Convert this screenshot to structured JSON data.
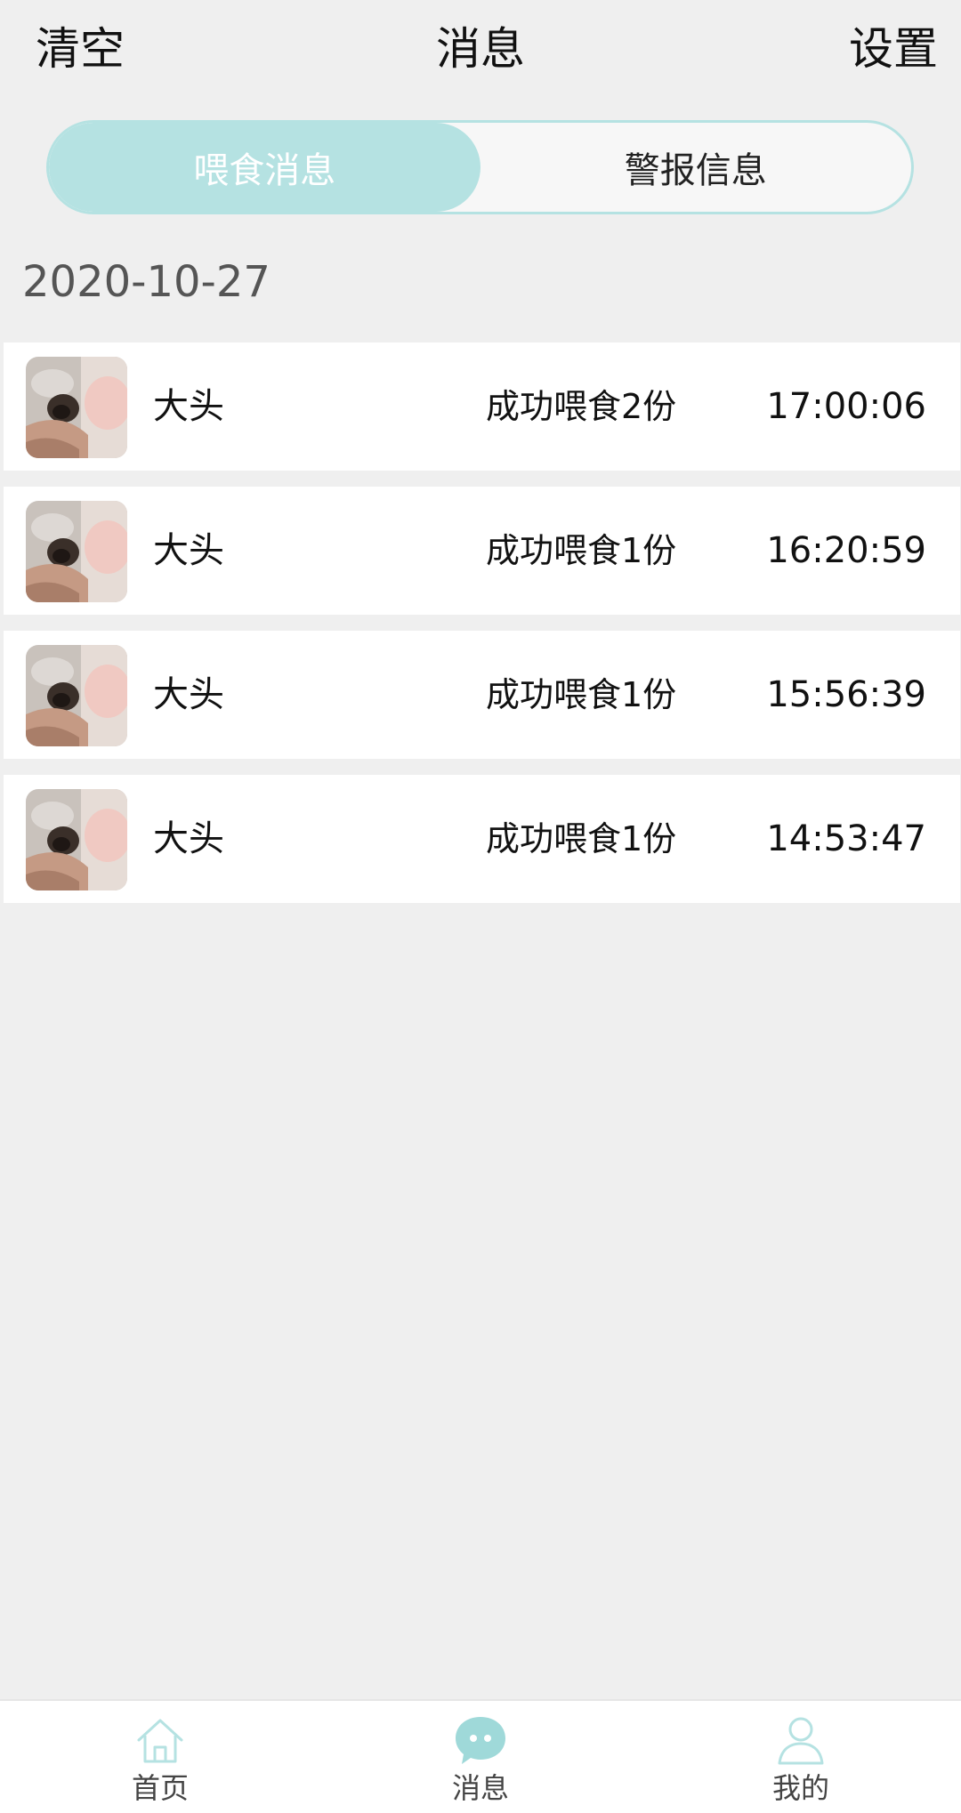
{
  "header": {
    "clear_label": "清空",
    "title": "消息",
    "settings_label": "设置"
  },
  "segmented": {
    "tabs": [
      {
        "label": "喂食消息",
        "active": true
      },
      {
        "label": "警报信息",
        "active": false
      }
    ]
  },
  "date_header": "2020-10-27",
  "messages": [
    {
      "name": "大头",
      "message": "成功喂食2份",
      "time": "17:00:06"
    },
    {
      "name": "大头",
      "message": "成功喂食1份",
      "time": "16:20:59"
    },
    {
      "name": "大头",
      "message": "成功喂食1份",
      "time": "15:56:39"
    },
    {
      "name": "大头",
      "message": "成功喂食1份",
      "time": "14:53:47"
    }
  ],
  "tabbar": {
    "items": [
      {
        "label": "首页",
        "icon": "home-icon",
        "active": false
      },
      {
        "label": "消息",
        "icon": "chat-bubble-icon",
        "active": true
      },
      {
        "label": "我的",
        "icon": "user-icon",
        "active": false
      }
    ]
  },
  "colors": {
    "accent": "#b5e2e2",
    "background": "#efefef"
  }
}
